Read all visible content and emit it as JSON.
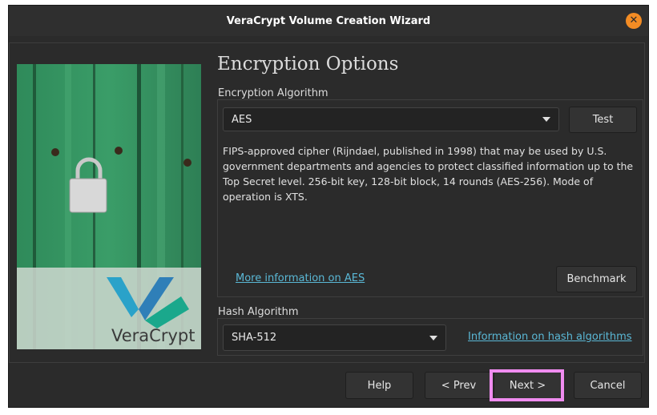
{
  "window": {
    "title": "VeraCrypt Volume Creation Wizard"
  },
  "page": {
    "heading": "Encryption Options"
  },
  "encryption": {
    "group_label": "Encryption Algorithm",
    "selected": "AES",
    "test_label": "Test",
    "description": "FIPS-approved cipher (Rijndael, published in 1998) that may be used by U.S. government departments and agencies to protect classified information up to the Top Secret level. 256-bit key, 128-bit block, 14 rounds (AES-256). Mode of operation is XTS.",
    "more_info_link": "More information on AES",
    "benchmark_label": "Benchmark"
  },
  "hash": {
    "group_label": "Hash Algorithm",
    "selected": "SHA-512",
    "info_link": "Information on hash algorithms"
  },
  "logo": {
    "text": "VeraCrypt"
  },
  "buttons": {
    "help": "Help",
    "prev": "< Prev",
    "next": "Next >",
    "cancel": "Cancel"
  },
  "colors": {
    "accent_link": "#5ab8d6",
    "close_button": "#f38c24",
    "highlight": "#f08cf0"
  }
}
